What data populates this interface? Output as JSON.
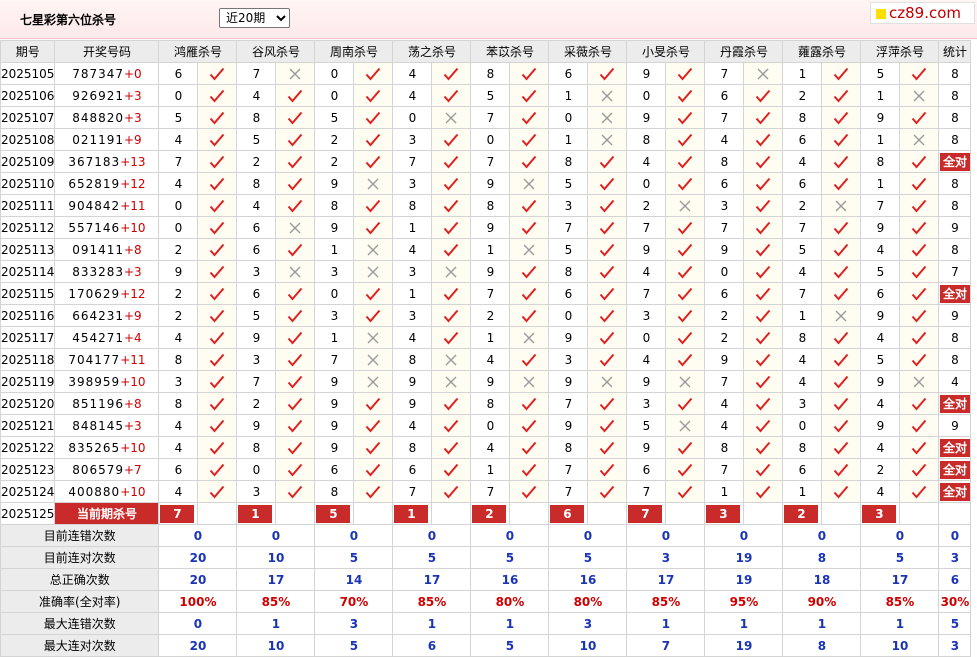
{
  "page": {
    "title": "七星彩第六位杀号",
    "period_select": "近20期",
    "logo_text": "cz89.com"
  },
  "headers": [
    "期号",
    "开奖号码",
    "鸿雁杀号",
    "谷风杀号",
    "周南杀号",
    "荡之杀号",
    "苯苡杀号",
    "采薇杀号",
    "小旻杀号",
    "丹霞杀号",
    "蕹露杀号",
    "浮萍杀号",
    "统计"
  ],
  "rows": [
    {
      "period": "2025105",
      "digits": "787347",
      "sum": "+0",
      "cells": [
        [
          "6",
          1
        ],
        [
          "7",
          0
        ],
        [
          "0",
          1
        ],
        [
          "4",
          1
        ],
        [
          "8",
          1
        ],
        [
          "6",
          1
        ],
        [
          "9",
          1
        ],
        [
          "7",
          0
        ],
        [
          "1",
          1
        ],
        [
          "5",
          1
        ]
      ],
      "stat": "8"
    },
    {
      "period": "2025106",
      "digits": "926921",
      "sum": "+3",
      "cells": [
        [
          "0",
          1
        ],
        [
          "4",
          1
        ],
        [
          "0",
          1
        ],
        [
          "4",
          1
        ],
        [
          "5",
          1
        ],
        [
          "1",
          0
        ],
        [
          "0",
          1
        ],
        [
          "6",
          1
        ],
        [
          "2",
          1
        ],
        [
          "1",
          0
        ]
      ],
      "stat": "8"
    },
    {
      "period": "2025107",
      "digits": "848820",
      "sum": "+3",
      "cells": [
        [
          "5",
          1
        ],
        [
          "8",
          1
        ],
        [
          "5",
          1
        ],
        [
          "0",
          0
        ],
        [
          "7",
          1
        ],
        [
          "0",
          0
        ],
        [
          "9",
          1
        ],
        [
          "7",
          1
        ],
        [
          "8",
          1
        ],
        [
          "9",
          1
        ]
      ],
      "stat": "8"
    },
    {
      "period": "2025108",
      "digits": "021191",
      "sum": "+9",
      "cells": [
        [
          "4",
          1
        ],
        [
          "5",
          1
        ],
        [
          "2",
          1
        ],
        [
          "3",
          1
        ],
        [
          "0",
          1
        ],
        [
          "1",
          0
        ],
        [
          "8",
          1
        ],
        [
          "4",
          1
        ],
        [
          "6",
          1
        ],
        [
          "1",
          0
        ]
      ],
      "stat": "8"
    },
    {
      "period": "2025109",
      "digits": "367183",
      "sum": "+13",
      "cells": [
        [
          "7",
          1
        ],
        [
          "2",
          1
        ],
        [
          "2",
          1
        ],
        [
          "7",
          1
        ],
        [
          "7",
          1
        ],
        [
          "8",
          1
        ],
        [
          "4",
          1
        ],
        [
          "8",
          1
        ],
        [
          "4",
          1
        ],
        [
          "8",
          1
        ]
      ],
      "stat": "全对"
    },
    {
      "period": "2025110",
      "digits": "652819",
      "sum": "+12",
      "cells": [
        [
          "4",
          1
        ],
        [
          "8",
          1
        ],
        [
          "9",
          0
        ],
        [
          "3",
          1
        ],
        [
          "9",
          0
        ],
        [
          "5",
          1
        ],
        [
          "0",
          1
        ],
        [
          "6",
          1
        ],
        [
          "6",
          1
        ],
        [
          "1",
          1
        ]
      ],
      "stat": "8"
    },
    {
      "period": "2025111",
      "digits": "904842",
      "sum": "+11",
      "cells": [
        [
          "0",
          1
        ],
        [
          "4",
          1
        ],
        [
          "8",
          1
        ],
        [
          "8",
          1
        ],
        [
          "8",
          1
        ],
        [
          "3",
          1
        ],
        [
          "2",
          0
        ],
        [
          "3",
          1
        ],
        [
          "2",
          0
        ],
        [
          "7",
          1
        ]
      ],
      "stat": "8"
    },
    {
      "period": "2025112",
      "digits": "557146",
      "sum": "+10",
      "cells": [
        [
          "0",
          1
        ],
        [
          "6",
          0
        ],
        [
          "9",
          1
        ],
        [
          "1",
          1
        ],
        [
          "9",
          1
        ],
        [
          "7",
          1
        ],
        [
          "7",
          1
        ],
        [
          "7",
          1
        ],
        [
          "7",
          1
        ],
        [
          "9",
          1
        ]
      ],
      "stat": "9"
    },
    {
      "period": "2025113",
      "digits": "091411",
      "sum": "+8",
      "cells": [
        [
          "2",
          1
        ],
        [
          "6",
          1
        ],
        [
          "1",
          0
        ],
        [
          "4",
          1
        ],
        [
          "1",
          0
        ],
        [
          "5",
          1
        ],
        [
          "9",
          1
        ],
        [
          "9",
          1
        ],
        [
          "5",
          1
        ],
        [
          "4",
          1
        ]
      ],
      "stat": "8"
    },
    {
      "period": "2025114",
      "digits": "833283",
      "sum": "+3",
      "cells": [
        [
          "9",
          1
        ],
        [
          "3",
          0
        ],
        [
          "3",
          0
        ],
        [
          "3",
          0
        ],
        [
          "9",
          1
        ],
        [
          "8",
          1
        ],
        [
          "4",
          1
        ],
        [
          "0",
          1
        ],
        [
          "4",
          1
        ],
        [
          "5",
          1
        ]
      ],
      "stat": "7"
    },
    {
      "period": "2025115",
      "digits": "170629",
      "sum": "+12",
      "cells": [
        [
          "2",
          1
        ],
        [
          "6",
          1
        ],
        [
          "0",
          1
        ],
        [
          "1",
          1
        ],
        [
          "7",
          1
        ],
        [
          "6",
          1
        ],
        [
          "7",
          1
        ],
        [
          "6",
          1
        ],
        [
          "7",
          1
        ],
        [
          "6",
          1
        ]
      ],
      "stat": "全对"
    },
    {
      "period": "2025116",
      "digits": "664231",
      "sum": "+9",
      "cells": [
        [
          "2",
          1
        ],
        [
          "5",
          1
        ],
        [
          "3",
          1
        ],
        [
          "3",
          1
        ],
        [
          "2",
          1
        ],
        [
          "0",
          1
        ],
        [
          "3",
          1
        ],
        [
          "2",
          1
        ],
        [
          "1",
          0
        ],
        [
          "9",
          1
        ]
      ],
      "stat": "9"
    },
    {
      "period": "2025117",
      "digits": "454271",
      "sum": "+4",
      "cells": [
        [
          "4",
          1
        ],
        [
          "9",
          1
        ],
        [
          "1",
          0
        ],
        [
          "4",
          1
        ],
        [
          "1",
          0
        ],
        [
          "9",
          1
        ],
        [
          "0",
          1
        ],
        [
          "2",
          1
        ],
        [
          "8",
          1
        ],
        [
          "4",
          1
        ]
      ],
      "stat": "8"
    },
    {
      "period": "2025118",
      "digits": "704177",
      "sum": "+11",
      "cells": [
        [
          "8",
          1
        ],
        [
          "3",
          1
        ],
        [
          "7",
          0
        ],
        [
          "8",
          0
        ],
        [
          "4",
          1
        ],
        [
          "3",
          1
        ],
        [
          "4",
          1
        ],
        [
          "9",
          1
        ],
        [
          "4",
          1
        ],
        [
          "5",
          1
        ]
      ],
      "stat": "8"
    },
    {
      "period": "2025119",
      "digits": "398959",
      "sum": "+10",
      "cells": [
        [
          "3",
          1
        ],
        [
          "7",
          1
        ],
        [
          "9",
          0
        ],
        [
          "9",
          0
        ],
        [
          "9",
          0
        ],
        [
          "9",
          0
        ],
        [
          "9",
          0
        ],
        [
          "7",
          1
        ],
        [
          "4",
          1
        ],
        [
          "9",
          0
        ]
      ],
      "stat": "4"
    },
    {
      "period": "2025120",
      "digits": "851196",
      "sum": "+8",
      "cells": [
        [
          "8",
          1
        ],
        [
          "2",
          1
        ],
        [
          "9",
          1
        ],
        [
          "9",
          1
        ],
        [
          "8",
          1
        ],
        [
          "7",
          1
        ],
        [
          "3",
          1
        ],
        [
          "4",
          1
        ],
        [
          "3",
          1
        ],
        [
          "4",
          1
        ]
      ],
      "stat": "全对"
    },
    {
      "period": "2025121",
      "digits": "848145",
      "sum": "+3",
      "cells": [
        [
          "4",
          1
        ],
        [
          "9",
          1
        ],
        [
          "9",
          1
        ],
        [
          "4",
          1
        ],
        [
          "0",
          1
        ],
        [
          "9",
          1
        ],
        [
          "5",
          0
        ],
        [
          "4",
          1
        ],
        [
          "0",
          1
        ],
        [
          "9",
          1
        ]
      ],
      "stat": "9"
    },
    {
      "period": "2025122",
      "digits": "835265",
      "sum": "+10",
      "cells": [
        [
          "4",
          1
        ],
        [
          "8",
          1
        ],
        [
          "9",
          1
        ],
        [
          "8",
          1
        ],
        [
          "4",
          1
        ],
        [
          "8",
          1
        ],
        [
          "9",
          1
        ],
        [
          "8",
          1
        ],
        [
          "8",
          1
        ],
        [
          "4",
          1
        ]
      ],
      "stat": "全对"
    },
    {
      "period": "2025123",
      "digits": "806579",
      "sum": "+7",
      "cells": [
        [
          "6",
          1
        ],
        [
          "0",
          1
        ],
        [
          "6",
          1
        ],
        [
          "6",
          1
        ],
        [
          "1",
          1
        ],
        [
          "7",
          1
        ],
        [
          "6",
          1
        ],
        [
          "7",
          1
        ],
        [
          "6",
          1
        ],
        [
          "2",
          1
        ]
      ],
      "stat": "全对"
    },
    {
      "period": "2025124",
      "digits": "400880",
      "sum": "+10",
      "cells": [
        [
          "4",
          1
        ],
        [
          "3",
          1
        ],
        [
          "8",
          1
        ],
        [
          "7",
          1
        ],
        [
          "7",
          1
        ],
        [
          "7",
          1
        ],
        [
          "7",
          1
        ],
        [
          "1",
          1
        ],
        [
          "1",
          1
        ],
        [
          "4",
          1
        ]
      ],
      "stat": "全对"
    }
  ],
  "current": {
    "period": "2025125",
    "label": "当前期杀号",
    "values": [
      "7",
      "1",
      "5",
      "1",
      "2",
      "6",
      "7",
      "3",
      "2",
      "3"
    ]
  },
  "stats": [
    {
      "label": "目前连错次数",
      "values": [
        "0",
        "0",
        "0",
        "0",
        "0",
        "0",
        "0",
        "0",
        "0",
        "0",
        "0"
      ],
      "red": false
    },
    {
      "label": "目前连对次数",
      "values": [
        "20",
        "10",
        "5",
        "5",
        "5",
        "5",
        "3",
        "19",
        "8",
        "5",
        "3"
      ],
      "red": false
    },
    {
      "label": "总正确次数",
      "values": [
        "20",
        "17",
        "14",
        "17",
        "16",
        "16",
        "17",
        "19",
        "18",
        "17",
        "6"
      ],
      "red": false
    },
    {
      "label": "准确率(全对率)",
      "values": [
        "100%",
        "85%",
        "70%",
        "85%",
        "80%",
        "80%",
        "85%",
        "95%",
        "90%",
        "85%",
        "30%"
      ],
      "red": true
    },
    {
      "label": "最大连错次数",
      "values": [
        "0",
        "1",
        "3",
        "1",
        "1",
        "3",
        "1",
        "1",
        "1",
        "1",
        "5"
      ],
      "red": false
    },
    {
      "label": "最大连对次数",
      "values": [
        "20",
        "10",
        "5",
        "6",
        "5",
        "10",
        "7",
        "19",
        "8",
        "10",
        "3"
      ],
      "red": false
    }
  ]
}
